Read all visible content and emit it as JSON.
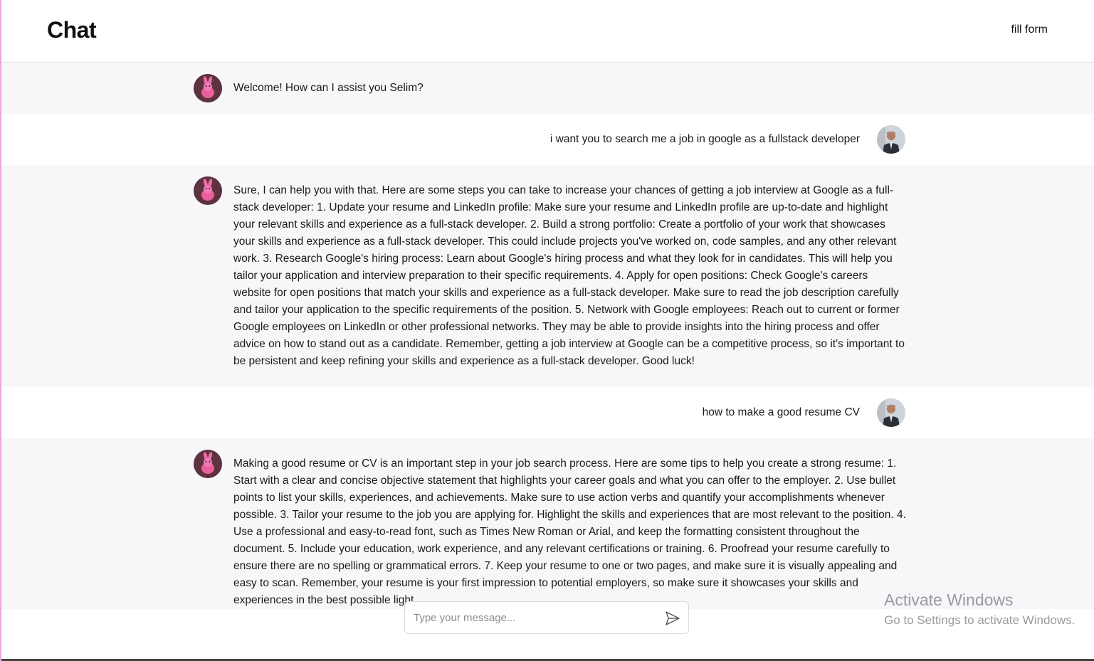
{
  "header": {
    "title": "Chat",
    "fill_form_link": "fill form"
  },
  "messages": [
    {
      "role": "bot",
      "text": "Welcome! How can I assist you Selim?"
    },
    {
      "role": "user",
      "text": "i want you to search me a job in google as a fullstack developer"
    },
    {
      "role": "bot",
      "text": "Sure, I can help you with that. Here are some steps you can take to increase your chances of getting a job interview at Google as a full-stack developer: 1. Update your resume and LinkedIn profile: Make sure your resume and LinkedIn profile are up-to-date and highlight your relevant skills and experience as a full-stack developer. 2. Build a strong portfolio: Create a portfolio of your work that showcases your skills and experience as a full-stack developer. This could include projects you've worked on, code samples, and any other relevant work. 3. Research Google's hiring process: Learn about Google's hiring process and what they look for in candidates. This will help you tailor your application and interview preparation to their specific requirements. 4. Apply for open positions: Check Google's careers website for open positions that match your skills and experience as a full-stack developer. Make sure to read the job description carefully and tailor your application to the specific requirements of the position. 5. Network with Google employees: Reach out to current or former Google employees on LinkedIn or other professional networks. They may be able to provide insights into the hiring process and offer advice on how to stand out as a candidate. Remember, getting a job interview at Google can be a competitive process, so it's important to be persistent and keep refining your skills and experience as a full-stack developer. Good luck!"
    },
    {
      "role": "user",
      "text": "how to make a good resume CV"
    },
    {
      "role": "bot",
      "text": "Making a good resume or CV is an important step in your job search process. Here are some tips to help you create a strong resume: 1. Start with a clear and concise objective statement that highlights your career goals and what you can offer to the employer. 2. Use bullet points to list your skills, experiences, and achievements. Make sure to use action verbs and quantify your accomplishments whenever possible. 3. Tailor your resume to the job you are applying for. Highlight the skills and experiences that are most relevant to the position. 4. Use a professional and easy-to-read font, such as Times New Roman or Arial, and keep the formatting consistent throughout the document. 5. Include your education, work experience, and any relevant certifications or training. 6. Proofread your resume carefully to ensure there are no spelling or grammatical errors. 7. Keep your resume to one or two pages, and make sure it is visually appealing and easy to scan. Remember, your resume is your first impression to potential employers, so make sure it showcases your skills and experiences in the best possible light."
    }
  ],
  "composer": {
    "placeholder": "Type your message...",
    "send_icon": "send-icon"
  },
  "watermark": {
    "line1": "Activate Windows",
    "line2": "Go to Settings to activate Windows."
  },
  "colors": {
    "bot_row_bg": "#f7f7fa",
    "user_row_bg": "#ffffff",
    "bot_avatar_pink": "#e8559a",
    "left_border": "#e8a6e0"
  }
}
